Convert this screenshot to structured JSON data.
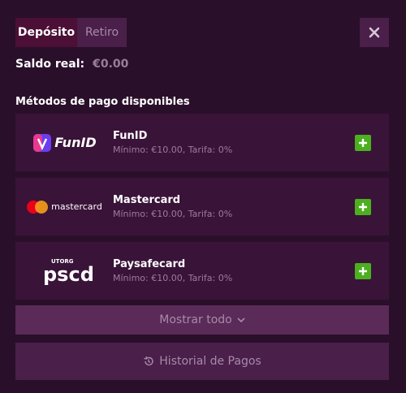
{
  "tabs": [
    {
      "label": "Depósito",
      "active": true
    },
    {
      "label": "Retiro",
      "active": false
    }
  ],
  "close_icon": "close-icon",
  "balance": {
    "label": "Saldo real:",
    "amount": "€0.00"
  },
  "section_title": "Métodos de pago disponibles",
  "methods": [
    {
      "name": "FunID",
      "details": "Mínimo: €10.00, Tarifa: 0%",
      "logo_text": "FunID",
      "icon": "plus-icon"
    },
    {
      "name": "Mastercard",
      "details": "Mínimo: €10.00, Tarifa: 0%",
      "logo_text": "mastercard",
      "icon": "plus-icon"
    },
    {
      "name": "Paysafecard",
      "details": "Mínimo: €10.00, Tarifa: 0%",
      "logo_text": "pscd",
      "logo_subtext": "UTORG",
      "icon": "plus-icon"
    }
  ],
  "show_all": {
    "label": "Mostrar todo",
    "icon": "chevron-down-icon"
  },
  "history": {
    "label": "Historial de Pagos",
    "icon": "history-icon"
  },
  "colors": {
    "background": "#2a0f2a",
    "card": "#3a1339",
    "accent_green": "#4caf1f",
    "tab_active": "#4c0f35"
  }
}
